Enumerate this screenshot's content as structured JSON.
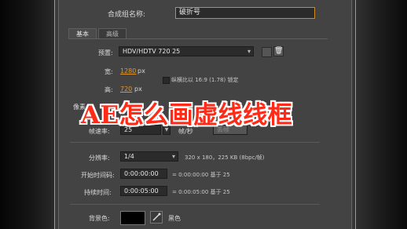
{
  "comp_name": {
    "label": "合成组名称:",
    "value": "破折号"
  },
  "tabs": [
    {
      "label": "基本"
    },
    {
      "label": "高级"
    }
  ],
  "preset": {
    "label": "预置:",
    "value": "HDV/HDTV 720 25"
  },
  "width": {
    "label": "宽:",
    "value": "1280",
    "unit": "px"
  },
  "height": {
    "label": "高:",
    "value": "720",
    "unit": "px"
  },
  "lock_aspect": {
    "label": "纵横比以 16:9 (1.78) 锁定",
    "checked": false
  },
  "pixel_aspect": {
    "label": "像素"
  },
  "frame_rate": {
    "label": "帧速率:",
    "value": "25",
    "unit": "帧/秒",
    "mode": "丢帧"
  },
  "resolution": {
    "label": "分辨率:",
    "value": "1/4",
    "info": "320 x 180，225 KB (8bpc/帧)"
  },
  "start_timecode": {
    "label": "开始时间码:",
    "value": "0:00:00:00",
    "info": "= 0:00:00:00  基于 25"
  },
  "duration": {
    "label": "持续时间:",
    "value": "0:00:05:00",
    "info": "= 0:00:05:00  基于 25"
  },
  "background": {
    "label": "背景色:",
    "color": "#000000",
    "name": "黑色"
  },
  "overlay_title": "AE怎么画虚线线框",
  "icons": [
    "chevron-down-icon",
    "save-preset-icon",
    "trash-icon",
    "eyedropper-icon"
  ]
}
